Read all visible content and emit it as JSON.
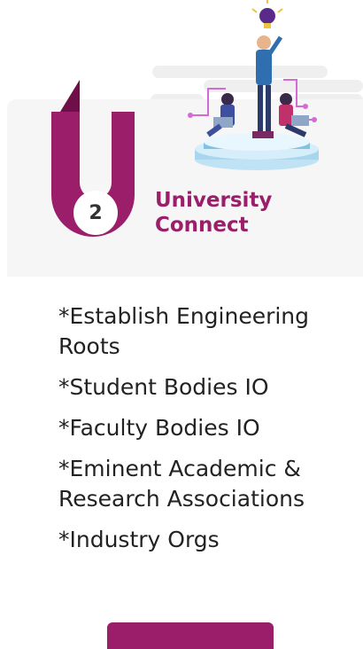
{
  "step": {
    "number": "2",
    "title_line1": "University",
    "title_line2": "Connect"
  },
  "items": [
    "*Establish Engineering Roots",
    "*Student Bodies IO",
    "*Faculty Bodies IO",
    "*Eminent Academic & Research Associations",
    "*Industry Orgs"
  ],
  "colors": {
    "accent": "#9b1e6b",
    "panel": "#f6f6f6",
    "text": "#222222"
  },
  "icons": [
    "lightbulb-icon",
    "team-illustration"
  ]
}
